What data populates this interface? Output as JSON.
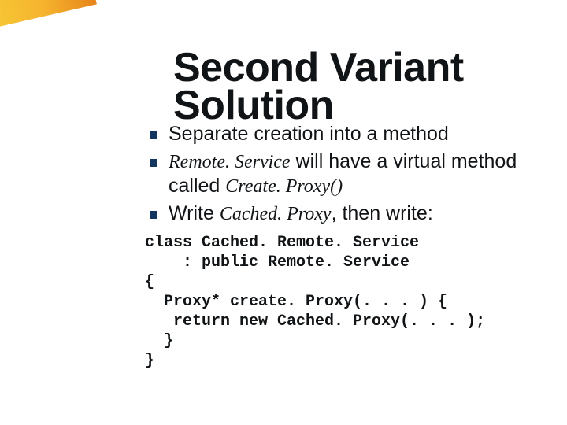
{
  "title_line1": "Second Variant",
  "title_line2": "Solution",
  "bullets": [
    {
      "segments": [
        {
          "text": "Separate creation into a method",
          "style": "plain"
        }
      ]
    },
    {
      "segments": [
        {
          "text": "Remote. Service",
          "style": "italic"
        },
        {
          "text": " will have a virtual method called ",
          "style": "plain"
        },
        {
          "text": "Create. Proxy()",
          "style": "italic"
        }
      ]
    },
    {
      "segments": [
        {
          "text": "Write ",
          "style": "plain"
        },
        {
          "text": "Cached. Proxy",
          "style": "italic"
        },
        {
          "text": ", then write:",
          "style": "plain"
        }
      ]
    }
  ],
  "code": "class Cached. Remote. Service\n    : public Remote. Service\n{\n  Proxy* create. Proxy(. . . ) {\n   return new Cached. Proxy(. . . );\n  }\n}"
}
